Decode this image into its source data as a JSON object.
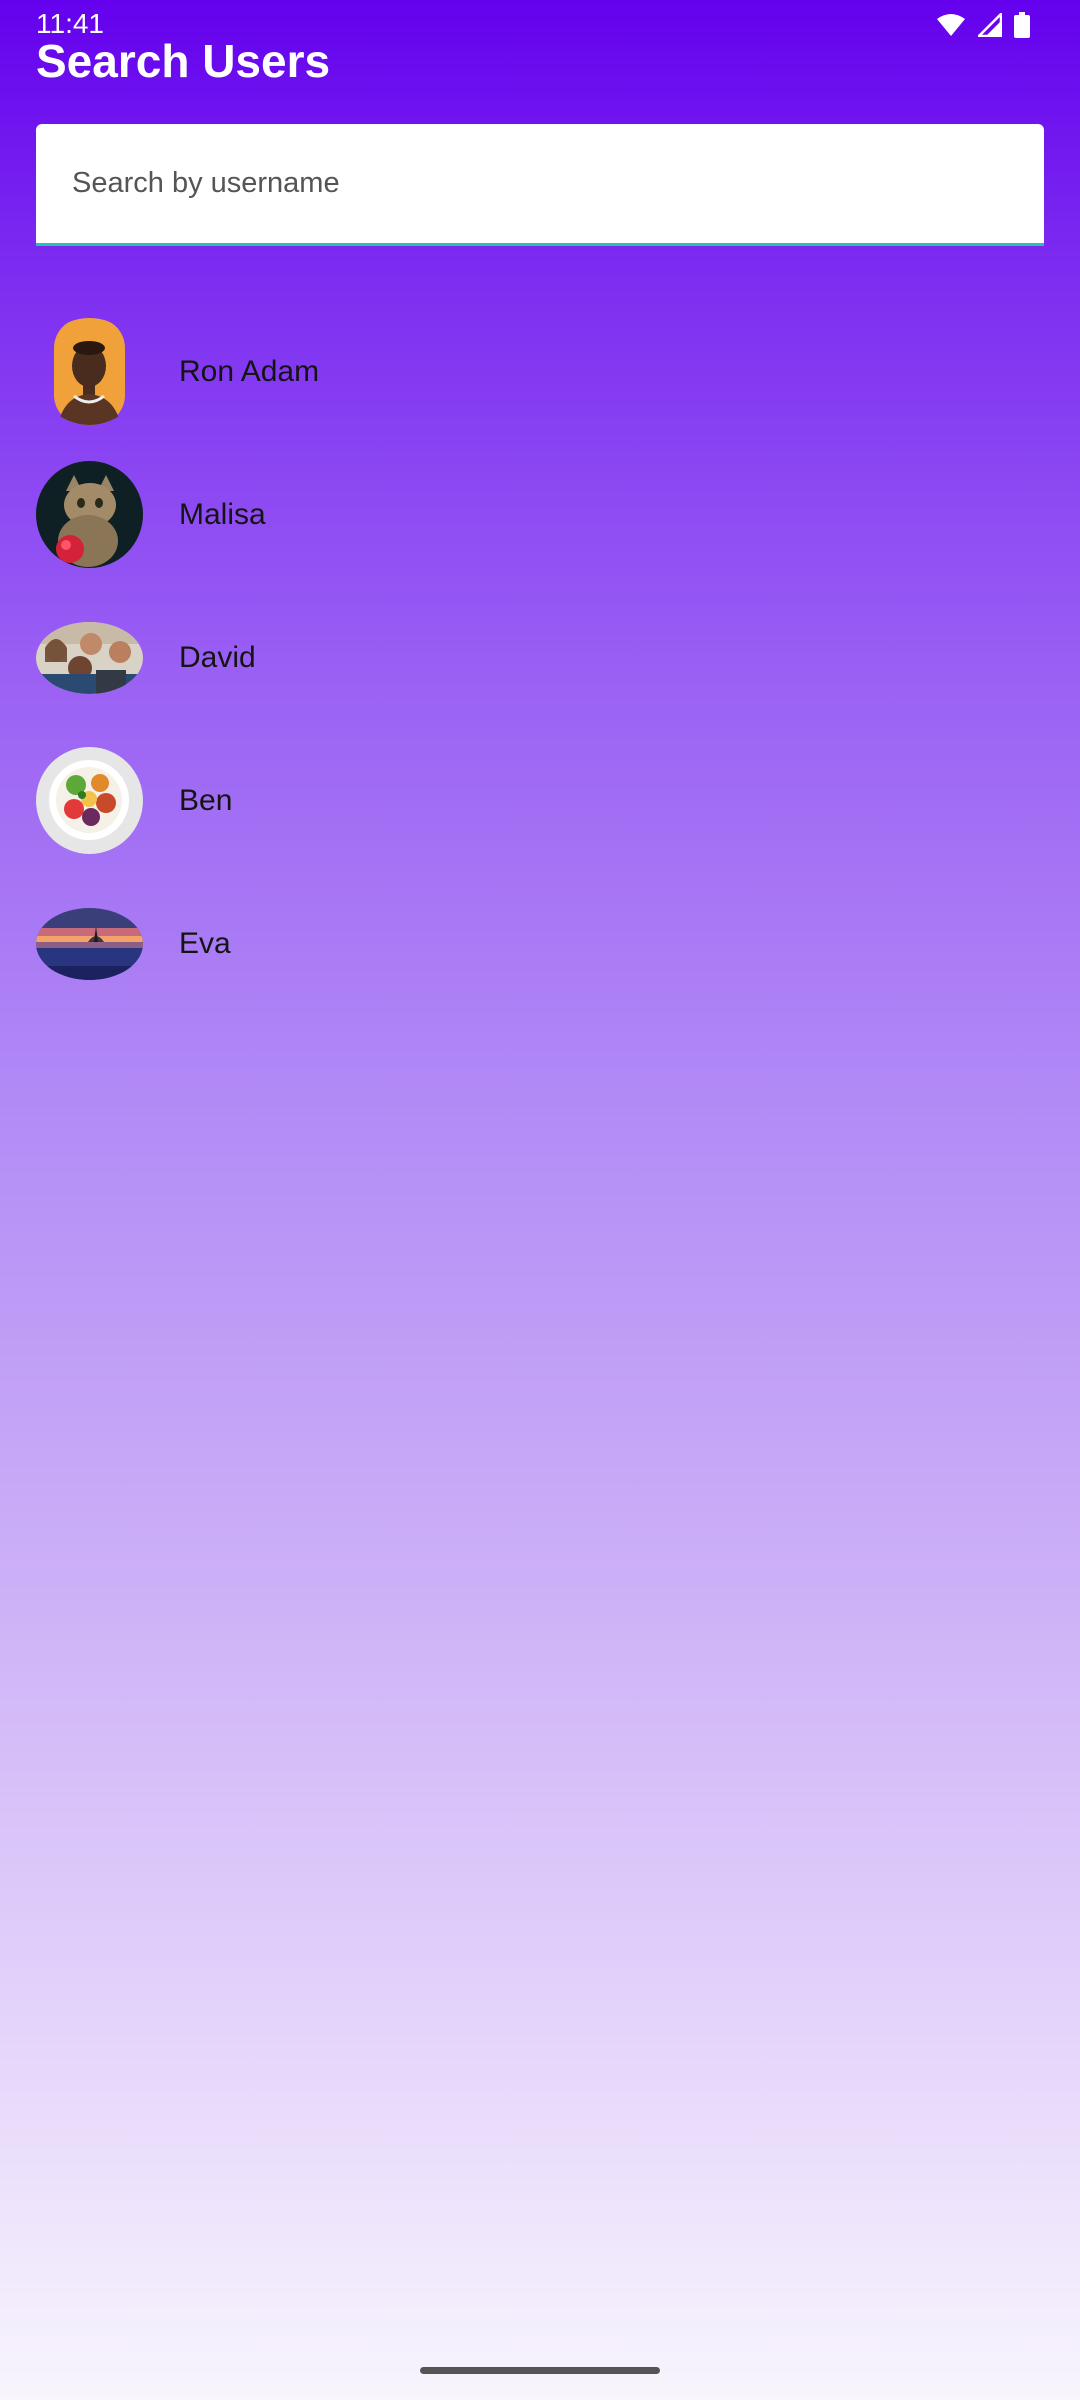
{
  "status_bar": {
    "time": "11:41",
    "icons": [
      "wifi-icon",
      "signal-icon",
      "battery-icon"
    ]
  },
  "header": {
    "title": "Search Users"
  },
  "search": {
    "placeholder": "Search by username",
    "value": "",
    "accent_color": "#25c1b2"
  },
  "users": [
    {
      "name": "Ron Adam",
      "avatar": "portrait-photo"
    },
    {
      "name": "Malisa",
      "avatar": "cat-photo"
    },
    {
      "name": "David",
      "avatar": "group-selfie-photo"
    },
    {
      "name": "Ben",
      "avatar": "salad-bowl-photo"
    },
    {
      "name": "Eva",
      "avatar": "sunset-lake-photo"
    }
  ],
  "theme": {
    "gradient_top": "#6400ee",
    "gradient_bottom": "#f8f5fd",
    "title_color": "#ffffff",
    "name_color": "#141414"
  }
}
